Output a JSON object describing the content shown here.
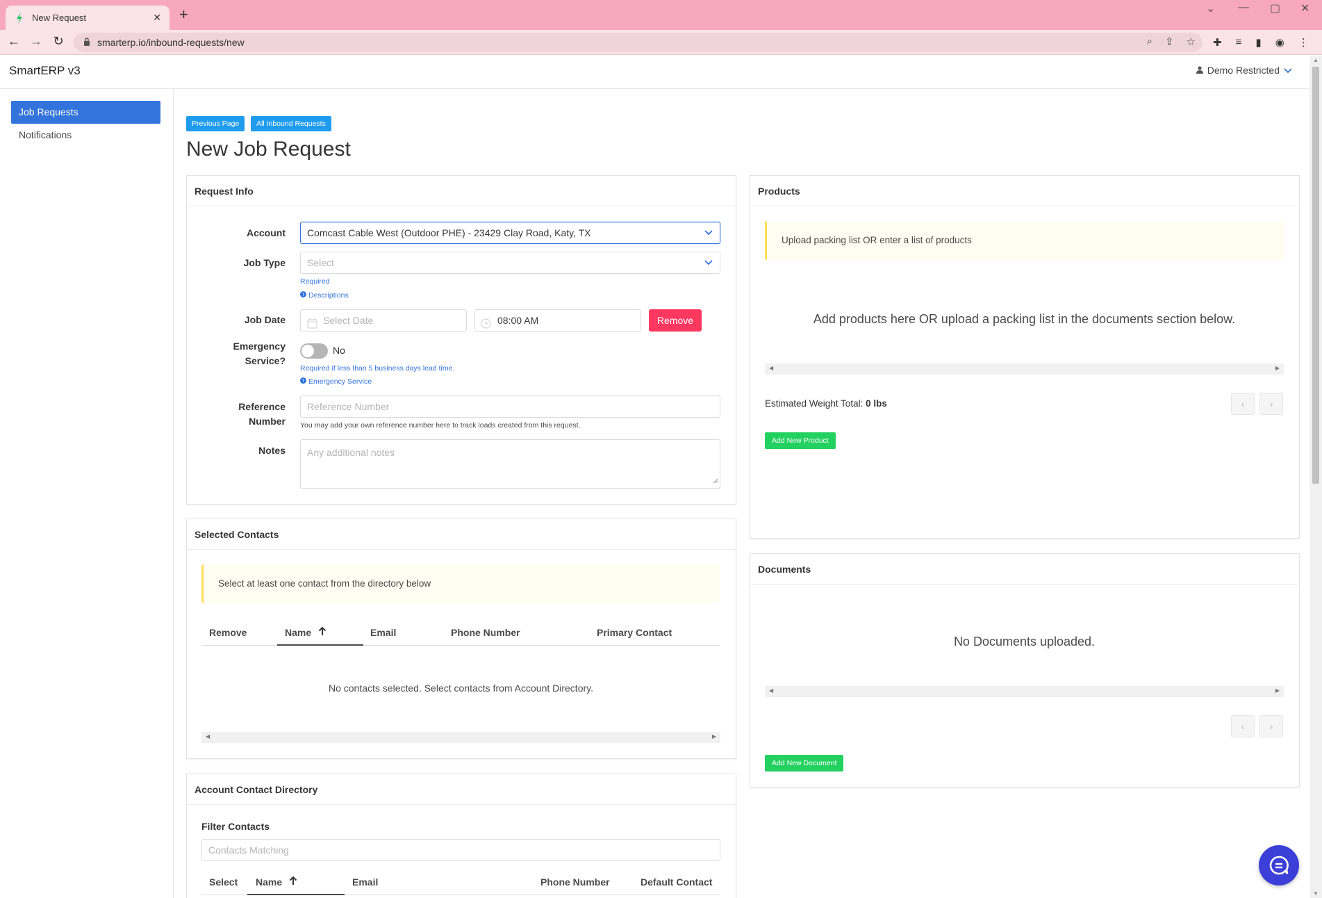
{
  "browser": {
    "tab_title": "New Request",
    "url": "smarterp.io/inbound-requests/new"
  },
  "app": {
    "brand": "SmartERP v3",
    "user": "Demo Restricted"
  },
  "sidebar": {
    "items": [
      {
        "label": "Job Requests",
        "active": true
      },
      {
        "label": "Notifications",
        "active": false
      }
    ]
  },
  "top_buttons": {
    "previous": "Previous Page",
    "all_inbound": "All Inbound Requests"
  },
  "page_title": "New Job Request",
  "request_info": {
    "header": "Request Info",
    "account_label": "Account",
    "account_value": "Comcast Cable West (Outdoor PHE) - 23429 Clay Road, Katy, TX",
    "job_type_label": "Job Type",
    "job_type_placeholder": "Select",
    "job_type_required": "Required",
    "job_type_descriptions": "Descriptions",
    "job_date_label": "Job Date",
    "date_placeholder": "Select Date",
    "time_value": "08:00 AM",
    "remove_button": "Remove",
    "emergency_label_1": "Emergency",
    "emergency_label_2": "Service?",
    "emergency_value": "No",
    "emergency_help": "Required if less than 5 business days lead time.",
    "emergency_link": "Emergency Service",
    "reference_label_1": "Reference",
    "reference_label_2": "Number",
    "reference_placeholder": "Reference Number",
    "reference_help": "You may add your own reference number here to track loads created from this request.",
    "notes_label": "Notes",
    "notes_placeholder": "Any additional notes"
  },
  "selected_contacts": {
    "header": "Selected Contacts",
    "notice": "Select at least one contact from the directory below",
    "columns": [
      "Remove",
      "Name",
      "Email",
      "Phone Number",
      "Primary Contact"
    ],
    "empty": "No contacts selected. Select contacts from Account Directory."
  },
  "directory": {
    "header": "Account Contact Directory",
    "filter_label": "Filter Contacts",
    "filter_placeholder": "Contacts Matching",
    "columns": [
      "Select",
      "Name",
      "Email",
      "Phone Number",
      "Default Contact"
    ]
  },
  "products": {
    "header": "Products",
    "notice": "Upload packing list OR enter a list of products",
    "empty": "Add products here OR upload a packing list in the documents section below.",
    "weight_label": "Estimated Weight Total:",
    "weight_value": "0 lbs",
    "add_button": "Add New Product"
  },
  "documents": {
    "header": "Documents",
    "empty": "No Documents uploaded.",
    "add_button": "Add New Document"
  },
  "colors": {
    "primary": "#3273dc",
    "info": "#209cee",
    "danger": "#ff3860",
    "success": "#23d160",
    "warning": "#ffdd57",
    "browser_frame": "#f8a8bc"
  }
}
